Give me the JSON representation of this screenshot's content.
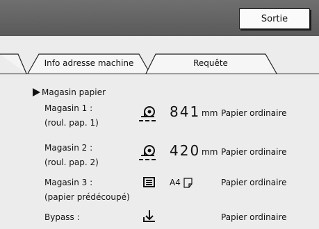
{
  "header": {
    "exit_label": "Sortie"
  },
  "tabs": [
    {
      "label": "Info adresse machine"
    },
    {
      "label": "Requête"
    }
  ],
  "section_title": "Magasin papier",
  "trays": [
    {
      "name": "Magasin 1 :",
      "sub": "(roul. pap. 1)",
      "icon": "roll-paper-icon",
      "size_value": "841",
      "size_unit": "mm",
      "paper_type": "Papier ordinaire"
    },
    {
      "name": "Magasin 2 :",
      "sub": "(roul. pap. 2)",
      "icon": "roll-paper-icon",
      "size_value": "420",
      "size_unit": "mm",
      "paper_type": "Papier ordinaire"
    },
    {
      "name": "Magasin 3 :",
      "sub": "(papier prédécoupé)",
      "icon": "paper-stack-icon",
      "size_value": "A4",
      "size_unit": "",
      "paper_type": "Papier ordinaire"
    },
    {
      "name": "Bypass :",
      "sub": "",
      "icon": "bypass-tray-icon",
      "size_value": "",
      "size_unit": "",
      "paper_type": "Papier ordinaire"
    }
  ]
}
